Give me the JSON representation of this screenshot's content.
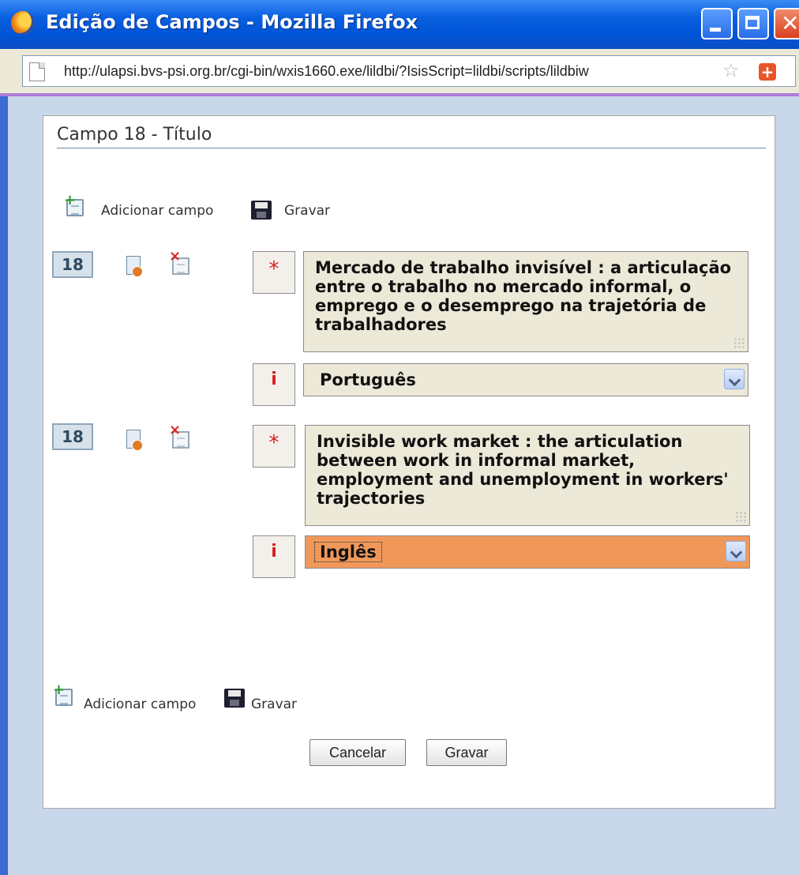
{
  "window": {
    "title": "Edição de Campos - Mozilla Firefox",
    "controls": {
      "minimize": "minimize",
      "maximize": "maximize",
      "close": "close"
    }
  },
  "addressbar": {
    "url": "http://ulapsi.bvs-psi.org.br/cgi-bin/wxis1660.exe/lildbi/?IsisScript=lildbi/scripts/lildbiw"
  },
  "panel": {
    "title": "Campo 18 - Título"
  },
  "toolbar_top": {
    "add_label": "Adicionar campo",
    "save_label": "Gravar"
  },
  "fields": [
    {
      "tag": "18",
      "required_marker": "*",
      "title": "Mercado de trabalho invisível : a articulação entre o trabalho no mercado informal, o emprego e o desemprego na trajetória de trabalhadores",
      "lang_marker": "i",
      "language": "Português"
    },
    {
      "tag": "18",
      "required_marker": "*",
      "title": "Invisible work market : the articulation between work in informal market, employment and unemployment in workers' trajectories",
      "lang_marker": "i",
      "language": "Inglês"
    }
  ],
  "toolbar_bottom": {
    "add_label": "Adicionar campo",
    "save_label": "Gravar"
  },
  "buttons": {
    "cancel": "Cancelar",
    "save": "Gravar"
  },
  "colors": {
    "titlebar": "#0054d6",
    "field_bg": "#ece9d8",
    "focused_select": "#f0985a",
    "marker_red": "#d81e1e"
  },
  "icons": [
    "firefox-logo-icon",
    "page-icon",
    "bookmark-star-icon",
    "addon-icon",
    "add-field-icon",
    "save-icon",
    "field-doc-icon",
    "delete-field-icon",
    "dropdown-arrow-icon"
  ]
}
